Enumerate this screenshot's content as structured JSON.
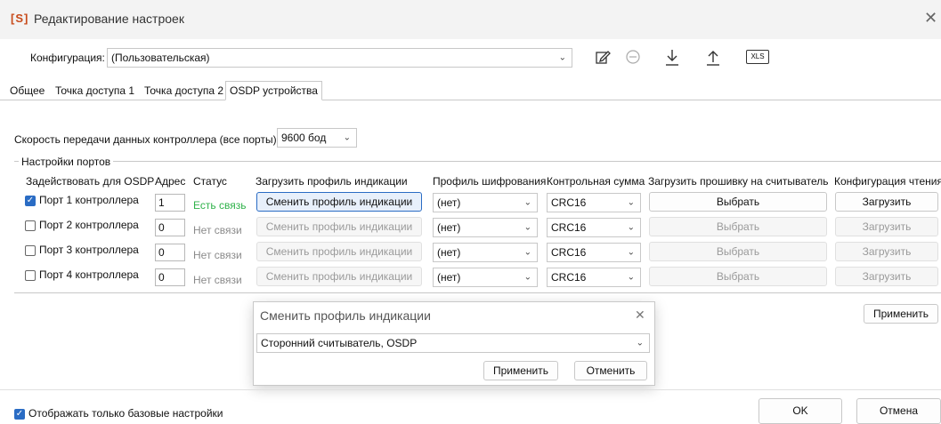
{
  "window": {
    "logo": "[S]",
    "title": "Редактирование настроек",
    "close": "✕"
  },
  "config": {
    "label": "Конфигурация:",
    "value": "(Пользовательская)"
  },
  "toolbar_icons": [
    "edit-icon",
    "minus-circle-icon",
    "download-icon",
    "upload-icon",
    "xls-icon"
  ],
  "xls_label": "XLS",
  "tabs": [
    {
      "label": "Общее",
      "active": false
    },
    {
      "label": "Точка доступа 1",
      "active": false
    },
    {
      "label": "Точка доступа 2",
      "active": false
    },
    {
      "label": "OSDP устройства",
      "active": true
    }
  ],
  "speed": {
    "label": "Скорость передачи данных контроллера (все порты):",
    "value": "9600 бод"
  },
  "ports_group": {
    "title": "Настройки портов",
    "headers": [
      "Задействовать для OSDP",
      "Адрес",
      "Статус",
      "Загрузить профиль индикации",
      "Профиль шифрования",
      "Контрольная сумма",
      "Загрузить прошивку на считыватель",
      "Конфигурация чтения"
    ],
    "rows": [
      {
        "checked": true,
        "port": "Порт 1 контроллера",
        "address": "1",
        "status": "Есть связь",
        "profile_btn": "Сменить профиль индикации",
        "encryption": "(нет)",
        "checksum": "CRC16",
        "firmware_btn": "Выбрать",
        "read_btn": "Загрузить"
      },
      {
        "checked": false,
        "port": "Порт 2 контроллера",
        "address": "0",
        "status": "Нет связи",
        "profile_btn": "Сменить профиль индикации",
        "encryption": "(нет)",
        "checksum": "CRC16",
        "firmware_btn": "Выбрать",
        "read_btn": "Загрузить"
      },
      {
        "checked": false,
        "port": "Порт 3 контроллера",
        "address": "0",
        "status": "Нет связи",
        "profile_btn": "Сменить профиль индикации",
        "encryption": "(нет)",
        "checksum": "CRC16",
        "firmware_btn": "Выбрать",
        "read_btn": "Загрузить"
      },
      {
        "checked": false,
        "port": "Порт 4 контроллера",
        "address": "0",
        "status": "Нет связи",
        "profile_btn": "Сменить профиль индикации",
        "encryption": "(нет)",
        "checksum": "CRC16",
        "firmware_btn": "Выбрать",
        "read_btn": "Загрузить"
      }
    ],
    "apply": "Применить"
  },
  "dialog": {
    "title": "Сменить профиль индикации",
    "close": "✕",
    "select_value": "Сторонний считыватель, OSDP",
    "apply": "Применить",
    "cancel": "Отменить"
  },
  "footer": {
    "basic_only": "Отображать только базовые настройки",
    "ok": "OK",
    "cancel": "Отмена"
  },
  "colors": {
    "accent": "#2a6cc4",
    "status_ok": "#2fb24a",
    "logo": "#c84a1a"
  }
}
